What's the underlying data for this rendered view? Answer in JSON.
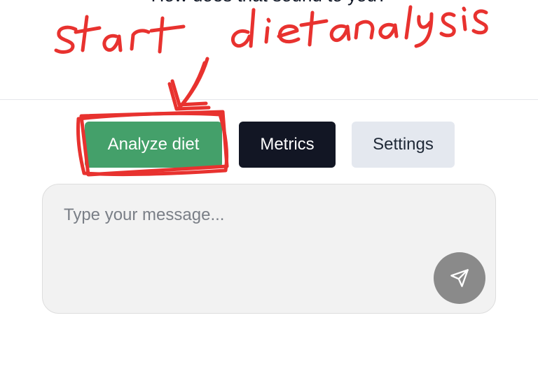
{
  "chat": {
    "previous_message_tail": "How does that sound to you?"
  },
  "actions": {
    "analyze_label": "Analyze diet",
    "metrics_label": "Metrics",
    "settings_label": "Settings"
  },
  "composer": {
    "placeholder": "Type your message...",
    "value": "",
    "send_icon": "send-paper-plane-icon"
  },
  "annotation": {
    "handwritten_text": "start diet analysis",
    "color": "#e8322f"
  },
  "colors": {
    "analyze_button": "#44a06a",
    "metrics_button": "#121624",
    "settings_button": "#e4e8ef",
    "send_button": "#8a8a8a"
  }
}
